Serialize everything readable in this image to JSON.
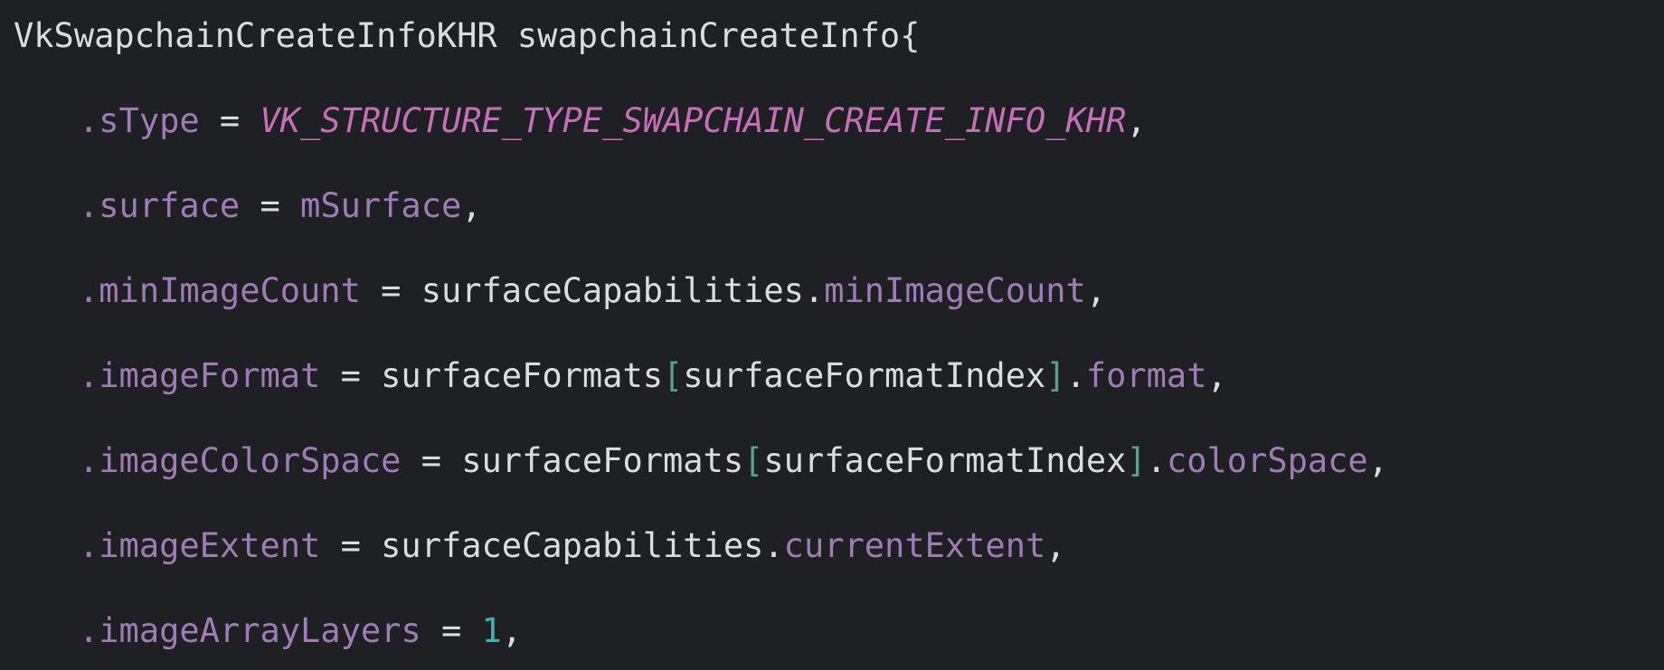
{
  "code": {
    "struct_type": "VkSwapchainCreateInfoKHR",
    "var_name": "swapchainCreateInfo",
    "open_brace": "{",
    "lines": [
      {
        "field": ".sType",
        "eq": " = ",
        "value": "VK_STRUCTURE_TYPE_SWAPCHAIN_CREATE_INFO_KHR",
        "end": ","
      },
      {
        "field": ".surface",
        "eq": " = ",
        "value": "mSurface",
        "end": ","
      },
      {
        "field": ".minImageCount",
        "eq": " = ",
        "object": "surfaceCapabilities",
        "dot": ".",
        "member": "minImageCount",
        "end": ","
      },
      {
        "field": ".imageFormat",
        "eq": " = ",
        "object": "surfaceFormats",
        "lbracket": "[",
        "index": "surfaceFormatIndex",
        "rbracket": "]",
        "dot": ".",
        "member": "format",
        "end": ","
      },
      {
        "field": ".imageColorSpace",
        "eq": " = ",
        "object": "surfaceFormats",
        "lbracket": "[",
        "index": "surfaceFormatIndex",
        "rbracket": "]",
        "dot": ".",
        "member": "colorSpace",
        "end": ","
      },
      {
        "field": ".imageExtent",
        "eq": " = ",
        "object": "surfaceCapabilities",
        "dot": ".",
        "member": "currentExtent",
        "end": ","
      },
      {
        "field": ".imageArrayLayers",
        "eq": " = ",
        "value": "1",
        "end": ","
      }
    ]
  },
  "colors": {
    "background": "#1f2024",
    "plain": "#dcdce0",
    "member": "#a07cb6",
    "enum": "#c56fb8",
    "number": "#36b5b5",
    "bracket": "#5aa08e"
  }
}
